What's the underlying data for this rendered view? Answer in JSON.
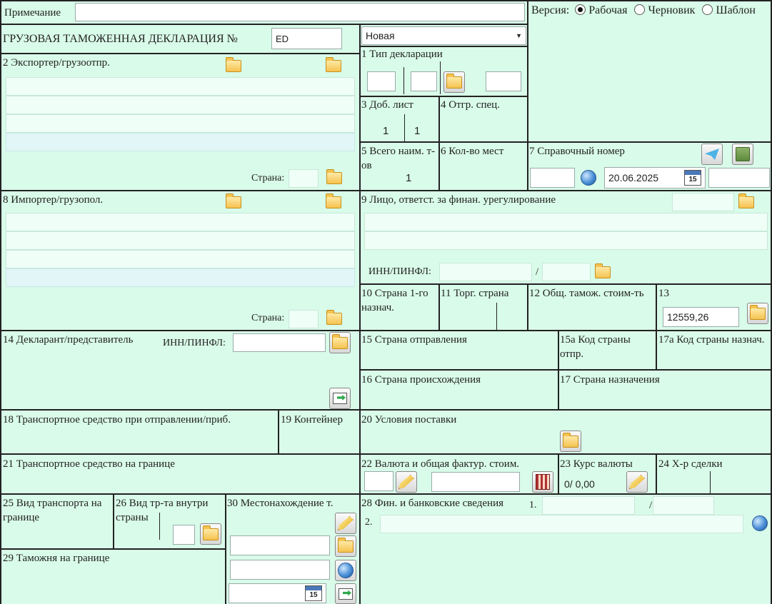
{
  "note": {
    "label": "Примечание",
    "value": ""
  },
  "version": {
    "label": "Версия:",
    "options": [
      "Рабочая",
      "Черновик",
      "Шаблон"
    ],
    "selected": "Рабочая"
  },
  "header": {
    "title": "ГРУЗОВАЯ ТАМОЖЕННАЯ ДЕКЛАРАЦИЯ №",
    "number": "ED",
    "status": "Новая"
  },
  "f1": {
    "label": "1 Тип декларации"
  },
  "f2": {
    "label": "2 Экспортер/грузоотпр.",
    "country_label": "Страна:"
  },
  "f3": {
    "label": "3 Доб. лист",
    "values": [
      "1",
      "1"
    ]
  },
  "f4": {
    "label": "4 Отгр. спец."
  },
  "f5": {
    "label": "5 Всего наим. т-ов",
    "value": "1"
  },
  "f6": {
    "label": "6 Кол-во мест"
  },
  "f7": {
    "label": "7 Справочный номер",
    "date": "20.06.2025"
  },
  "f8": {
    "label": "8 Импортер/грузопол.",
    "country_label": "Страна:"
  },
  "f9": {
    "label": "9 Лицо, ответст. за финан. урегулирование",
    "inn_label": "ИНН/ПИНФЛ:",
    "slash": "/"
  },
  "f10": {
    "label": "10 Страна 1-го назнач."
  },
  "f11": {
    "label": "11 Торг. страна"
  },
  "f12": {
    "label": "12 Общ. тамож. стоим-ть"
  },
  "f13": {
    "label": "13",
    "value": "12559,26"
  },
  "f14": {
    "label": "14 Декларант/представитель",
    "inn_label": "ИНН/ПИНФЛ:"
  },
  "f15": {
    "label": "15 Страна отправления"
  },
  "f15a": {
    "label": "15a Код страны отпр."
  },
  "f16": {
    "label": "16 Страна происхождения"
  },
  "f17": {
    "label": "17 Страна назначения"
  },
  "f17a": {
    "label": "17a Код страны назнач."
  },
  "f18": {
    "label": "18 Транспортное средство при отправлении/приб."
  },
  "f19": {
    "label": "19 Контейнер"
  },
  "f20": {
    "label": "20 Условия поставки"
  },
  "f21": {
    "label": "21 Транспортное средство на границе"
  },
  "f22": {
    "label": "22 Валюта и общая фактур. стоим."
  },
  "f23": {
    "label": "23 Курс валюты",
    "value": "0/ 0,00"
  },
  "f24": {
    "label": "24 Х-р сделки"
  },
  "f25": {
    "label": "25 Вид транспорта на границе"
  },
  "f26": {
    "label": "26 Вид тр-та внутри страны"
  },
  "f28": {
    "label": "28 Фин. и банковские сведения",
    "row1": "1.",
    "row2": "2.",
    "slash": "/"
  },
  "f29": {
    "label": "29 Таможня на границе"
  },
  "f30": {
    "label": "30 Местонахождение т."
  },
  "calendar_day": "15",
  "icons": [
    "folder-icon",
    "calendar-icon",
    "globe-icon",
    "paper-plane-icon",
    "archive-icon",
    "export-arrow-icon",
    "edit-icon",
    "calculator-icon"
  ]
}
